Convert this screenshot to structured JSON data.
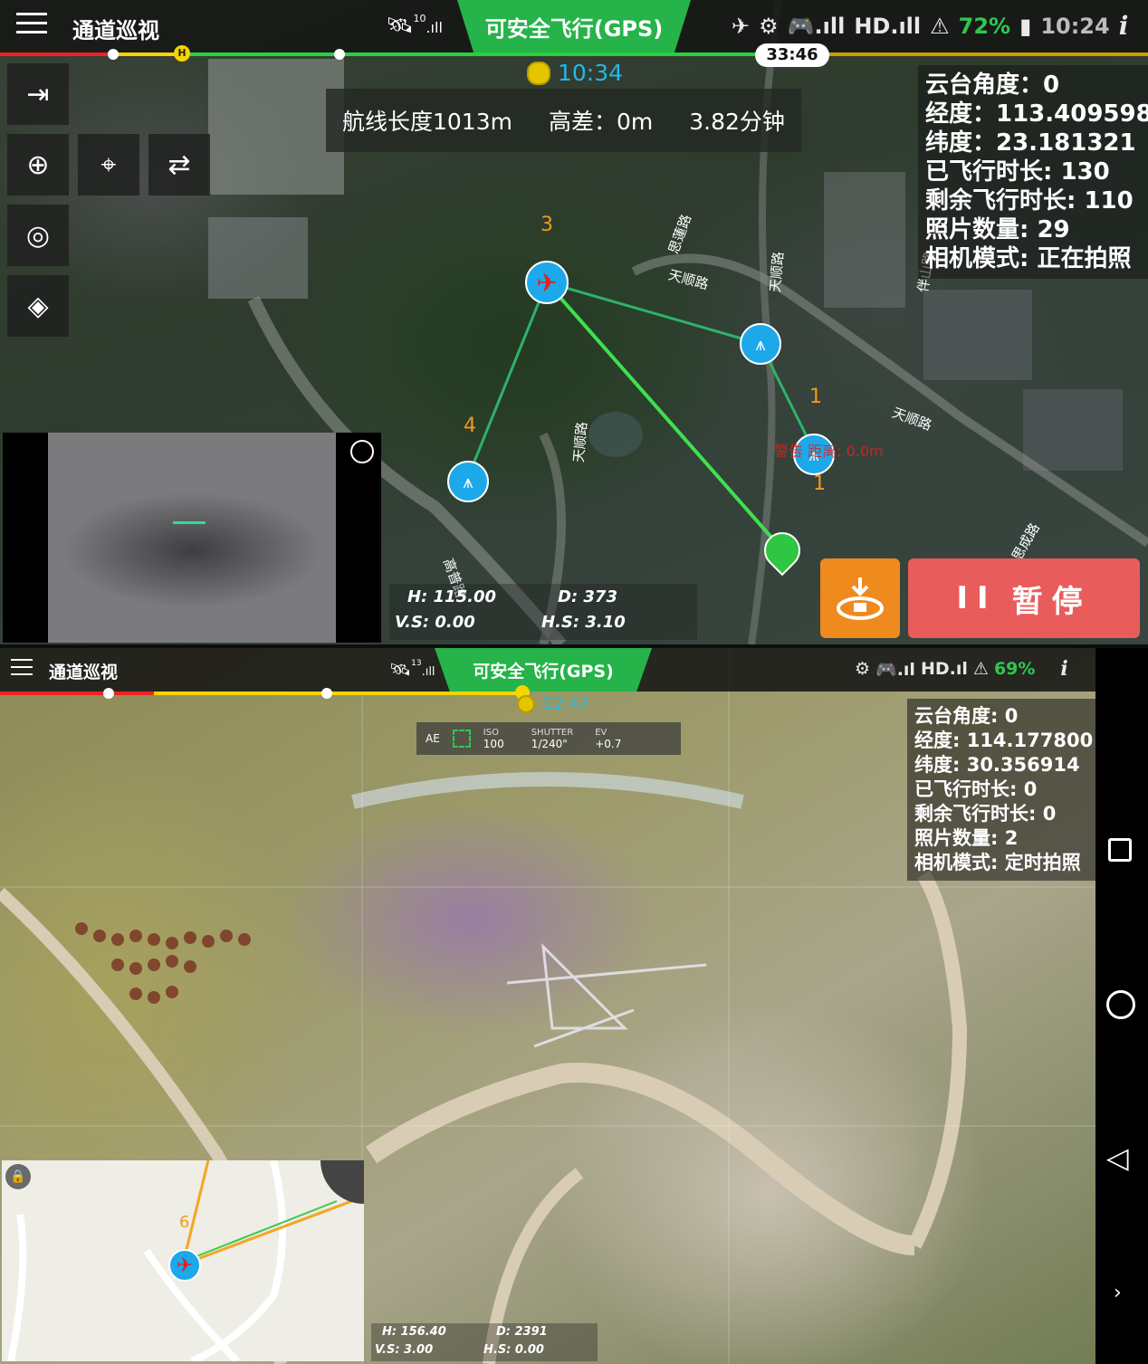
{
  "top": {
    "app_title": "通道巡视",
    "gps_status": "可安全飞行(GPS)",
    "satellites": "10",
    "hd_label": "HD",
    "battery_pct": "72%",
    "clock": "10:24",
    "flight_timer": "33:46",
    "home_label": "H",
    "route_clock": "10:34",
    "route_length": "航线长度1013m",
    "height_diff": "高差：0m",
    "duration": "3.82分钟",
    "info": [
      "云台角度：0",
      "经度：113.409598",
      "纬度：23.181321",
      "已飞行时长: 130",
      "剩余飞行时长: 110",
      "照片数量: 29",
      "相机模式: 正在拍照"
    ],
    "waypoints": [
      "3",
      "4",
      "1",
      "1"
    ],
    "roads": [
      "思蓮路",
      "天顺路",
      "天顺路",
      "天顺路",
      "伴山路",
      "高普路",
      "天顺路",
      "思成路"
    ],
    "telemetry": {
      "h": "H: 115.00",
      "d": "D: 373",
      "vs": "V.S: 0.00",
      "hs": "H.S: 3.10"
    },
    "pause_label": "暂停",
    "pause_icon": "II",
    "red_text": "警告 距离: 0.0m"
  },
  "bottom": {
    "app_title": "通道巡视",
    "gps_status": "可安全飞行(GPS)",
    "satellites": "13",
    "hd_label": "HD",
    "battery_pct": "69%",
    "route_clock": "12:47",
    "camera": {
      "ae": "AE",
      "iso_label": "ISO",
      "iso": "100",
      "shutter_label": "SHUTTER",
      "shutter": "1/240\"",
      "ev_label": "EV",
      "ev": "+0.7"
    },
    "info": [
      "云台角度: 0",
      "经度: 114.177800",
      "纬度: 30.356914",
      "已飞行时长: 0",
      "剩余飞行时长: 0",
      "照片数量: 2",
      "相机模式: 定时拍照"
    ],
    "minimap_wp": "6",
    "telemetry": {
      "h": "H: 156.40",
      "d": "D: 2391",
      "vs": "V.S: 3.00",
      "hs": "H.S: 0.00"
    }
  },
  "colors": {
    "gps_green": "#26b34a",
    "pause_red": "#e95c5c",
    "land_orange": "#ef8a1e",
    "waypoint_blue": "#1da8ea",
    "timer_cyan": "#23b8e8"
  }
}
